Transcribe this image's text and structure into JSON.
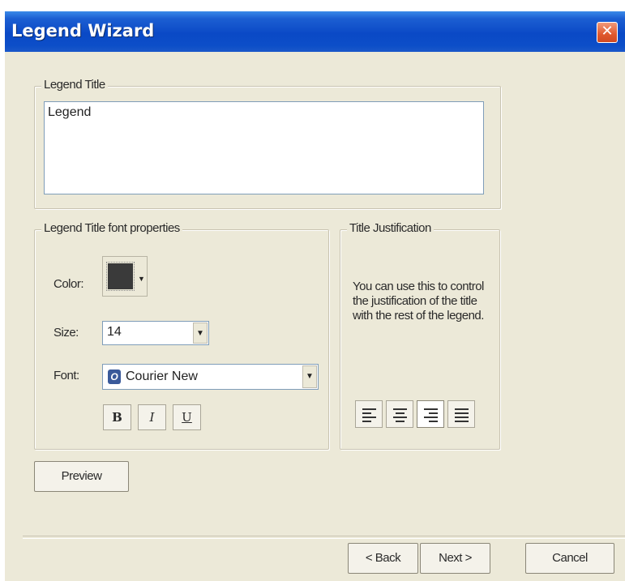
{
  "window": {
    "title": "Legend Wizard",
    "close_glyph": "✕"
  },
  "legend_title_group": {
    "label": "Legend Title",
    "value": "Legend"
  },
  "font_group": {
    "label": "Legend Title font properties",
    "color_label": "Color:",
    "color_value": "#3a3a3a",
    "size_label": "Size:",
    "size_value": "14",
    "font_label": "Font:",
    "font_value": "Courier New",
    "bold_label": "B",
    "italic_label": "I",
    "underline_label": "U"
  },
  "justification_group": {
    "label": "Title Justification",
    "description": "You can use this to control the justification of the title with the rest of the legend.",
    "buttons": [
      "align-left-icon",
      "align-center-icon",
      "align-right-icon",
      "align-justify-icon"
    ],
    "selected": "align-right-icon"
  },
  "buttons": {
    "preview": "Preview",
    "back": "< Back",
    "next": "Next >",
    "cancel": "Cancel"
  }
}
